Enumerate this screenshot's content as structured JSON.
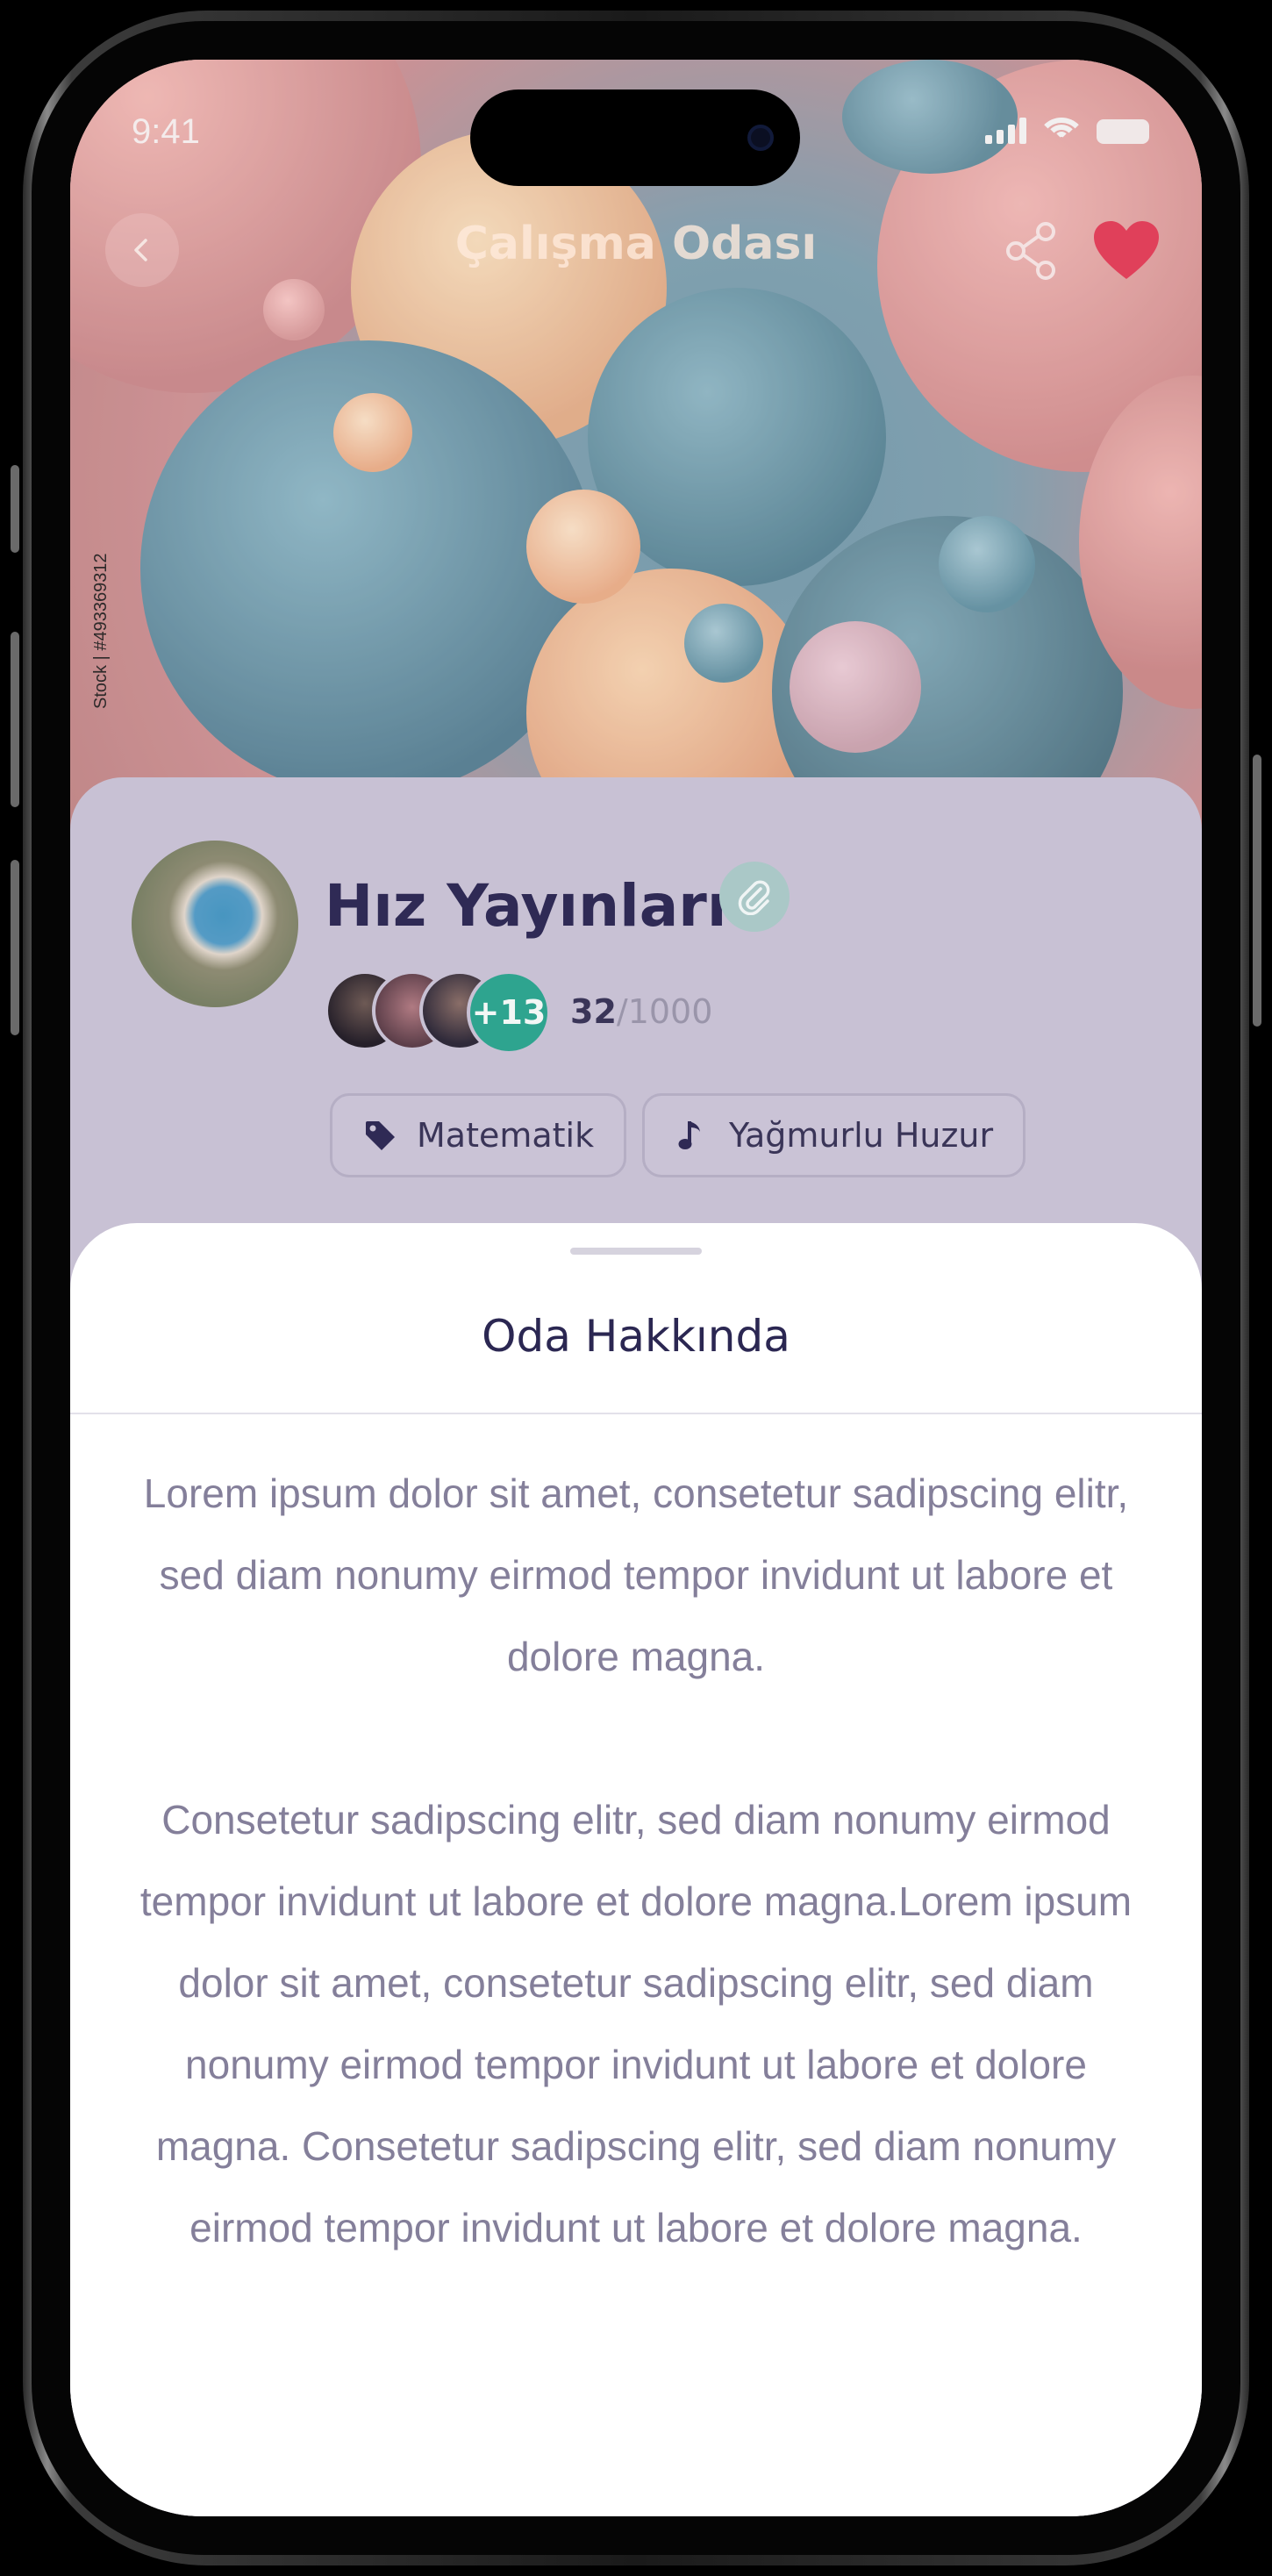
{
  "status_bar": {
    "time": "9:41"
  },
  "header": {
    "title": "Çalışma Odası",
    "back_icon": "chevron-left-icon",
    "share_icon": "share-icon",
    "favorite_icon": "heart-icon"
  },
  "hero": {
    "watermark": "Stock | #493369312"
  },
  "room": {
    "name": "Hız Yayınları",
    "members_more": "+13",
    "capacity_current": "32",
    "capacity_max": "/1000",
    "tags": [
      {
        "label": "Matematik",
        "icon": "tag-icon"
      },
      {
        "label": "Yağmurlu Huzur",
        "icon": "music-note-icon"
      }
    ]
  },
  "sheet": {
    "title": "Oda Hakkında",
    "paragraphs": [
      "Lorem ipsum dolor sit amet, consetetur sadipscing elitr, sed diam nonumy eirmod tempor invidunt ut labore et dolore magna.",
      "Consetetur sadipscing elitr, sed diam nonumy eirmod tempor invidunt ut labore et dolore magna.Lorem ipsum dolor sit amet, consetetur sadipscing elitr, sed diam nonumy eirmod tempor invidunt ut labore et dolore magna. Consetetur sadipscing elitr, sed diam nonumy eirmod tempor invidunt ut labore et dolore magna."
    ]
  },
  "colors": {
    "accent_teal": "#2ea48f",
    "heart_red": "#e0405a",
    "title_navy": "#2f2a55",
    "body_gray": "#847f9a"
  }
}
